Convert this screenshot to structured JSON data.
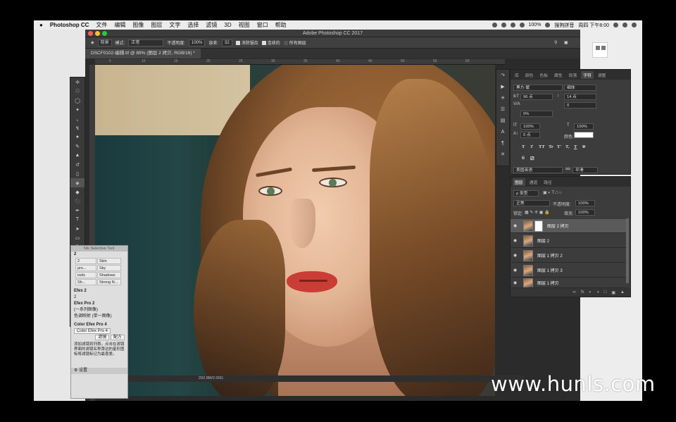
{
  "menubar": {
    "apple": "",
    "app_name": "Photoshop CC",
    "items": [
      "文件",
      "编辑",
      "图像",
      "图层",
      "文字",
      "选择",
      "滤镜",
      "3D",
      "视图",
      "窗口",
      "帮助"
    ],
    "battery": "100%",
    "input_method": "搜狗拼音",
    "clock": "周四 下午8:00"
  },
  "window": {
    "title": "Adobe Photoshop CC 2017"
  },
  "options_bar": {
    "preset": "前景",
    "mode_label": "模式:",
    "mode_value": "正常",
    "opacity_label": "不透明度:",
    "opacity_value": "100%",
    "tolerance_label": "容差:",
    "tolerance_value": "32",
    "antialias": "消除锯齿",
    "contiguous": "连续的",
    "all_layers": "所有图层"
  },
  "document": {
    "tab": "DSCF0102-编辑.tif @ 89% (图层 2 拷贝, RGB/16) *",
    "status": "292.8M/2.00G",
    "ruler_marks": [
      "5",
      "10",
      "15",
      "20",
      "25",
      "30",
      "35",
      "40",
      "45",
      "50",
      "55",
      "60"
    ]
  },
  "nik_panel": {
    "title": "Nik Selective Tool",
    "row1": "2",
    "grid": [
      [
        "2",
        "Skin"
      ],
      [
        "pro...",
        "Sky"
      ],
      [
        "ixels",
        "Shadows"
      ],
      [
        "Sh...",
        "Strong N..."
      ]
    ],
    "section2": "Efex 2",
    "sub2": "2",
    "efex": "Efex Pro 2",
    "efex_sub1": "(一系列图像)",
    "efex_sub2": "色调映射 (单一图像)",
    "cep4": "Color Efex Pro 4",
    "cep4_btn": "Color Efex Pro 4",
    "filter_btn": "滤镜",
    "recipe_btn": "配方",
    "help_text": "添加滤镜到列表。点击在滤镜界面的滤镜名称旁边的星形图标将滤镜标记为最喜爱。",
    "footer": "设置"
  },
  "char_panel": {
    "tabs": [
      "库",
      "颜色",
      "色板",
      "属性",
      "段落",
      "字符",
      "调整"
    ],
    "active_tab": "字符",
    "font_family": "黑方-繁",
    "font_style": "细体",
    "font_size": "96 点",
    "leading": "14 点",
    "kerning": "V/A",
    "tracking": "0",
    "tsume": "0%",
    "vscale": "100%",
    "hscale": "100%",
    "baseline": "0 点",
    "color_label": "颜色:",
    "style_buttons": [
      "T",
      "T",
      "TT",
      "Tr",
      "T'",
      "T,",
      "T",
      "T"
    ],
    "language": "美国英语",
    "antialias": "平滑"
  },
  "layers_panel": {
    "tabs": [
      "图层",
      "通道",
      "路径"
    ],
    "filter": "ρ 类型",
    "blend": "正常",
    "opacity_label": "不透明度:",
    "opacity": "100%",
    "lock_label": "锁定:",
    "fill_label": "填充:",
    "fill": "100%",
    "layers": [
      {
        "name": "图层 2 拷贝",
        "selected": true,
        "mask": true
      },
      {
        "name": "图层 2",
        "selected": false,
        "mask": false
      },
      {
        "name": "图层 1 拷贝 2",
        "selected": false,
        "mask": false
      },
      {
        "name": "图层 1 拷贝 3",
        "selected": false,
        "mask": false
      },
      {
        "name": "图层 1 拷贝",
        "selected": false,
        "mask": false
      }
    ],
    "footer_icons": [
      "link-icon",
      "fx-icon",
      "mask-icon",
      "adjustment-icon",
      "group-icon",
      "new-layer-icon",
      "trash-icon"
    ]
  },
  "watermark": "www.hunls.com",
  "colors": {
    "ps_dark": "#2b2b2b",
    "panel": "#3c3c3c",
    "lips": "#c93d36",
    "traffic_red": "#ff5f57",
    "traffic_yellow": "#febc2e",
    "traffic_green": "#28c840"
  }
}
